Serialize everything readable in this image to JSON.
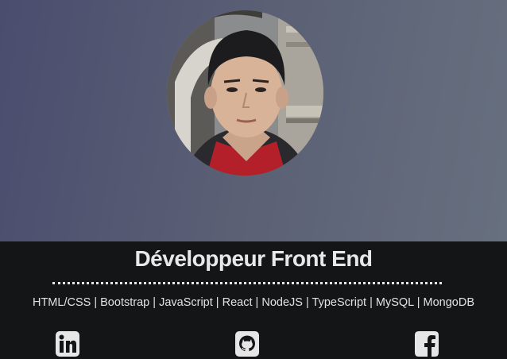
{
  "profile": {
    "title": "Développeur Front End",
    "skills": [
      "HTML/CSS",
      "Bootstrap",
      "JavaScript",
      "React",
      "NodeJS",
      "TypeScript",
      "MySQL",
      "MongoDB"
    ],
    "separator": "|"
  },
  "social": [
    {
      "name": "linkedin",
      "icon": "linkedin-icon"
    },
    {
      "name": "github",
      "icon": "github-icon"
    },
    {
      "name": "facebook",
      "icon": "facebook-icon"
    }
  ],
  "colors": {
    "hero_start": "#4a4d6e",
    "hero_end": "#67707f",
    "footer_bg": "#141516",
    "text": "#e8e8ea"
  }
}
